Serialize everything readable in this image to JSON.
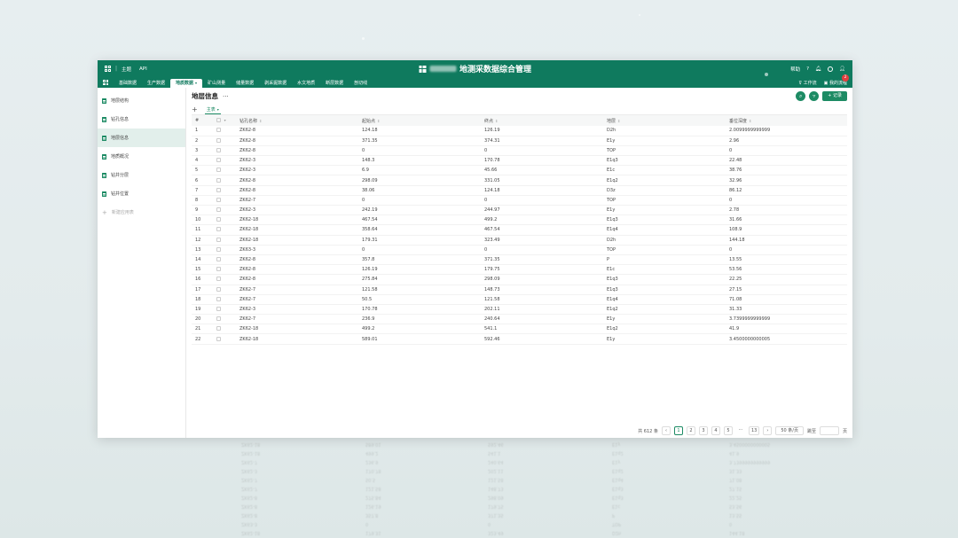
{
  "topbar": {
    "theme_label": "主题",
    "api_label": "API",
    "app_title": "地测采数据综合管理",
    "help_label": "帮助"
  },
  "tabs": [
    {
      "label": "基础数据",
      "active": false
    },
    {
      "label": "生产数据",
      "active": false
    },
    {
      "label": "地质数据",
      "active": true
    },
    {
      "label": "矿山测量",
      "active": false
    },
    {
      "label": "储量数据",
      "active": false
    },
    {
      "label": "剥采掘数据",
      "active": false
    },
    {
      "label": "水文地质",
      "active": false
    },
    {
      "label": "断层数据",
      "active": false
    },
    {
      "label": "剖切线",
      "active": false
    }
  ],
  "tabbar_right": {
    "workspace_label": "工作流",
    "my_approval_label": "我的流程",
    "badge_count": "2"
  },
  "sidebar": {
    "items": [
      {
        "label": "地层结构",
        "active": false
      },
      {
        "label": "钻孔信息",
        "active": false
      },
      {
        "label": "地层信息",
        "active": true
      },
      {
        "label": "地质概况",
        "active": false
      },
      {
        "label": "钻井分层",
        "active": false
      },
      {
        "label": "钻井位置",
        "active": false
      }
    ],
    "add_label": "新建应用表"
  },
  "main": {
    "title": "地层信息",
    "more": "···",
    "add_record_label": "记录",
    "view_label": "主表"
  },
  "table": {
    "columns": [
      "#",
      "钻孔名称",
      "起始点",
      "终点",
      "地层",
      "垂位深度"
    ],
    "rows": [
      [
        "1",
        "ZK62-8",
        "124.18",
        "126.19",
        "D2h",
        "2.0099999999999"
      ],
      [
        "2",
        "ZK62-8",
        "371.35",
        "374.31",
        "E1y",
        "2.96"
      ],
      [
        "3",
        "ZK62-8",
        "0",
        "0",
        "TOP",
        "0"
      ],
      [
        "4",
        "ZK62-3",
        "148.3",
        "170.78",
        "E1q3",
        "22.48"
      ],
      [
        "5",
        "ZK62-3",
        "6.9",
        "45.66",
        "E1c",
        "38.76"
      ],
      [
        "6",
        "ZK62-8",
        "298.09",
        "331.05",
        "E1q2",
        "32.96"
      ],
      [
        "7",
        "ZK62-8",
        "38.06",
        "124.18",
        "D3z",
        "86.12"
      ],
      [
        "8",
        "ZK62-7",
        "0",
        "0",
        "TOP",
        "0"
      ],
      [
        "9",
        "ZK62-3",
        "242.19",
        "244.97",
        "E1y",
        "2.78"
      ],
      [
        "10",
        "ZK62-18",
        "467.54",
        "499.2",
        "E1q3",
        "31.66"
      ],
      [
        "11",
        "ZK62-18",
        "358.64",
        "467.54",
        "E1q4",
        "108.9"
      ],
      [
        "12",
        "ZK62-18",
        "179.31",
        "323.49",
        "D2h",
        "144.18"
      ],
      [
        "13",
        "ZK63-3",
        "0",
        "0",
        "TOP",
        "0"
      ],
      [
        "14",
        "ZK62-8",
        "357.8",
        "371.35",
        "P",
        "13.55"
      ],
      [
        "15",
        "ZK62-8",
        "126.19",
        "179.75",
        "E1c",
        "53.56"
      ],
      [
        "16",
        "ZK62-8",
        "275.84",
        "298.09",
        "E1q3",
        "22.25"
      ],
      [
        "17",
        "ZK62-7",
        "121.58",
        "148.73",
        "E1q3",
        "27.15"
      ],
      [
        "18",
        "ZK62-7",
        "50.5",
        "121.58",
        "E1q4",
        "71.08"
      ],
      [
        "19",
        "ZK62-3",
        "170.78",
        "202.11",
        "E1q2",
        "31.33"
      ],
      [
        "20",
        "ZK62-7",
        "236.9",
        "240.64",
        "E1y",
        "3.7399999999999"
      ],
      [
        "21",
        "ZK62-18",
        "499.2",
        "541.1",
        "E1q2",
        "41.9"
      ],
      [
        "22",
        "ZK62-18",
        "589.01",
        "592.46",
        "E1y",
        "3.4500000000005"
      ]
    ]
  },
  "pager": {
    "total": "共 612 条",
    "prev": "‹",
    "pages": [
      "1",
      "2",
      "3",
      "4",
      "5"
    ],
    "ellipsis": "···",
    "last": "13",
    "next": "›",
    "page_size": "50 条/页",
    "jump_label": "跳至",
    "page_suffix": "页"
  },
  "colors": {
    "brand": "#0f7a5e",
    "accent": "#1d8b64"
  }
}
